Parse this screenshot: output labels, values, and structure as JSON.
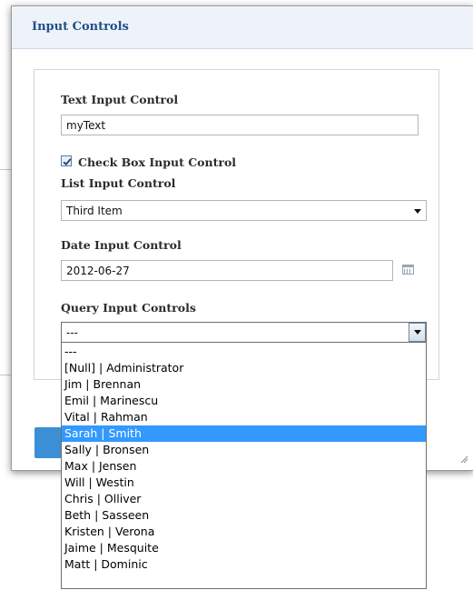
{
  "dialog": {
    "title": "Input Controls",
    "text_control": {
      "label": "Text Input Control",
      "value": "myText"
    },
    "checkbox_control": {
      "label": "Check Box Input Control",
      "checked": true
    },
    "list_control": {
      "label": "List Input Control",
      "value": "Third Item"
    },
    "date_control": {
      "label": "Date Input Control",
      "value": "2012-06-27"
    },
    "query_control": {
      "label": "Query Input Controls",
      "value": "---",
      "options": [
        "---",
        "[Null] | Administrator",
        "Jim | Brennan",
        "Emil | Marinescu",
        "Vital | Rahman",
        "Sarah | Smith",
        "Sally | Bronsen",
        "Max | Jensen",
        "Will | Westin",
        "Chris | Olliver",
        "Beth | Sasseen",
        "Kristen | Verona",
        "Jaime | Mesquite",
        "Matt | Dominic"
      ],
      "highlighted": "Sarah | Smith"
    }
  },
  "colors": {
    "title": "#1f4f86",
    "header_bg": "#eef3f9",
    "highlight": "#3399ff",
    "button": "#3c8fd6"
  }
}
